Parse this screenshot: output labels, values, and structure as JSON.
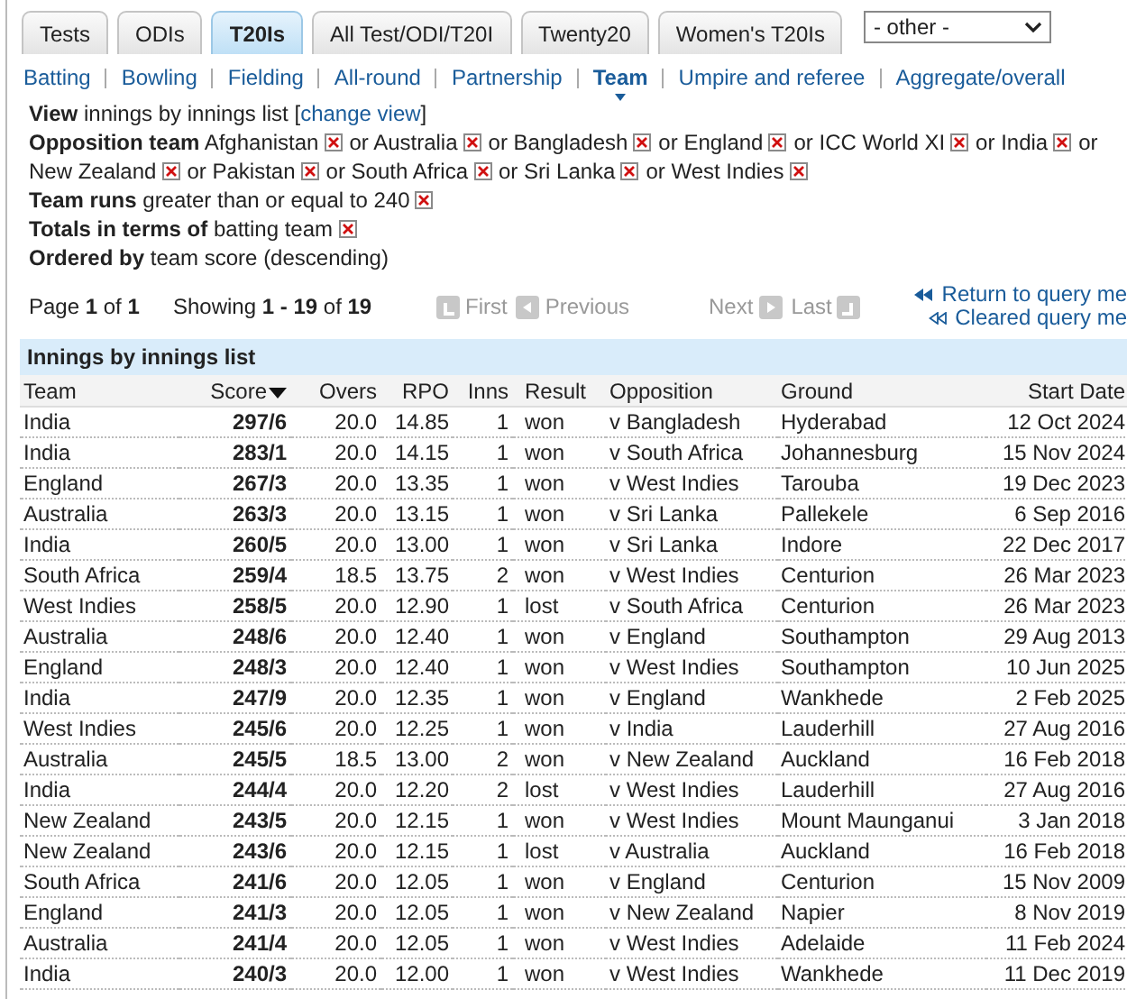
{
  "tabs": [
    {
      "label": "Tests",
      "selected": false
    },
    {
      "label": "ODIs",
      "selected": false
    },
    {
      "label": "T20Is",
      "selected": true
    },
    {
      "label": "All Test/ODI/T20I",
      "selected": false
    },
    {
      "label": "Twenty20",
      "selected": false
    },
    {
      "label": "Women's T20Is",
      "selected": false
    }
  ],
  "other_select": {
    "value": "- other -"
  },
  "subnav": [
    {
      "label": "Batting",
      "selected": false
    },
    {
      "label": "Bowling",
      "selected": false
    },
    {
      "label": "Fielding",
      "selected": false
    },
    {
      "label": "All-round",
      "selected": false
    },
    {
      "label": "Partnership",
      "selected": false
    },
    {
      "label": "Team",
      "selected": true
    },
    {
      "label": "Umpire and referee",
      "selected": false
    },
    {
      "label": "Aggregate/overall",
      "selected": false
    }
  ],
  "view": {
    "label": "View",
    "text": "innings by innings list",
    "open_bracket": "[",
    "link": "change view",
    "close_bracket": "]"
  },
  "criteria": [
    {
      "label": "Opposition team",
      "values": [
        {
          "text": "Afghanistan"
        },
        {
          "prefix": "or",
          "text": "Australia"
        },
        {
          "prefix": "or",
          "text": "Bangladesh"
        },
        {
          "prefix": "or",
          "text": "England"
        },
        {
          "prefix": "or",
          "text": "ICC World XI"
        },
        {
          "prefix": "or",
          "text": "India"
        },
        {
          "prefix": "or",
          "text": "New Zealand"
        },
        {
          "prefix": "or",
          "text": "Pakistan"
        },
        {
          "prefix": "or",
          "text": "South Africa"
        },
        {
          "prefix": "or",
          "text": "Sri Lanka"
        },
        {
          "prefix": "or",
          "text": "West Indies"
        }
      ]
    },
    {
      "label": "Team runs",
      "values": [
        {
          "text": "greater than or equal to 240"
        }
      ]
    },
    {
      "label": "Totals in terms of",
      "values": [
        {
          "text": "batting team"
        }
      ]
    }
  ],
  "ordered_by": {
    "label": "Ordered by",
    "text": "team score (descending)"
  },
  "pagination": {
    "page": "Page **1** of **1**",
    "showing": "Showing **1 - 19** of **19**",
    "buttons": [
      {
        "label": "First",
        "kind": "first",
        "disabled": true
      },
      {
        "label": "Previous",
        "kind": "previous",
        "disabled": true
      },
      {
        "label": "Next",
        "kind": "next",
        "disabled": true
      },
      {
        "label": "Last",
        "kind": "last",
        "disabled": true
      }
    ]
  },
  "query_links": [
    "Return to query me",
    "Cleared query me"
  ],
  "table": {
    "title": "Innings by innings list",
    "columns": [
      {
        "label": "Team",
        "sorted": false
      },
      {
        "label": "Score",
        "sorted": true
      },
      {
        "label": "Overs",
        "sorted": false
      },
      {
        "label": "RPO",
        "sorted": false
      },
      {
        "label": "Inns",
        "sorted": false
      },
      {
        "label": "Result",
        "sorted": false
      },
      {
        "label": "Opposition",
        "sorted": false
      },
      {
        "label": "Ground",
        "sorted": false
      },
      {
        "label": "Start Date",
        "sorted": false
      }
    ],
    "rows": [
      [
        "India",
        "297/6",
        "20.0",
        "14.85",
        "1",
        "won",
        "v Bangladesh",
        "Hyderabad",
        "12 Oct 2024"
      ],
      [
        "India",
        "283/1",
        "20.0",
        "14.15",
        "1",
        "won",
        "v South Africa",
        "Johannesburg",
        "15 Nov 2024"
      ],
      [
        "England",
        "267/3",
        "20.0",
        "13.35",
        "1",
        "won",
        "v West Indies",
        "Tarouba",
        "19 Dec 2023"
      ],
      [
        "Australia",
        "263/3",
        "20.0",
        "13.15",
        "1",
        "won",
        "v Sri Lanka",
        "Pallekele",
        "6 Sep 2016"
      ],
      [
        "India",
        "260/5",
        "20.0",
        "13.00",
        "1",
        "won",
        "v Sri Lanka",
        "Indore",
        "22 Dec 2017"
      ],
      [
        "South Africa",
        "259/4",
        "18.5",
        "13.75",
        "2",
        "won",
        "v West Indies",
        "Centurion",
        "26 Mar 2023"
      ],
      [
        "West Indies",
        "258/5",
        "20.0",
        "12.90",
        "1",
        "lost",
        "v South Africa",
        "Centurion",
        "26 Mar 2023"
      ],
      [
        "Australia",
        "248/6",
        "20.0",
        "12.40",
        "1",
        "won",
        "v England",
        "Southampton",
        "29 Aug 2013"
      ],
      [
        "England",
        "248/3",
        "20.0",
        "12.40",
        "1",
        "won",
        "v West Indies",
        "Southampton",
        "10 Jun 2025"
      ],
      [
        "India",
        "247/9",
        "20.0",
        "12.35",
        "1",
        "won",
        "v England",
        "Wankhede",
        "2 Feb 2025"
      ],
      [
        "West Indies",
        "245/6",
        "20.0",
        "12.25",
        "1",
        "won",
        "v India",
        "Lauderhill",
        "27 Aug 2016"
      ],
      [
        "Australia",
        "245/5",
        "18.5",
        "13.00",
        "2",
        "won",
        "v New Zealand",
        "Auckland",
        "16 Feb 2018"
      ],
      [
        "India",
        "244/4",
        "20.0",
        "12.20",
        "2",
        "lost",
        "v West Indies",
        "Lauderhill",
        "27 Aug 2016"
      ],
      [
        "New Zealand",
        "243/5",
        "20.0",
        "12.15",
        "1",
        "won",
        "v West Indies",
        "Mount Maunganui",
        "3 Jan 2018"
      ],
      [
        "New Zealand",
        "243/6",
        "20.0",
        "12.15",
        "1",
        "lost",
        "v Australia",
        "Auckland",
        "16 Feb 2018"
      ],
      [
        "South Africa",
        "241/6",
        "20.0",
        "12.05",
        "1",
        "won",
        "v England",
        "Centurion",
        "15 Nov 2009"
      ],
      [
        "England",
        "241/3",
        "20.0",
        "12.05",
        "1",
        "won",
        "v New Zealand",
        "Napier",
        "8 Nov 2019"
      ],
      [
        "Australia",
        "241/4",
        "20.0",
        "12.05",
        "1",
        "won",
        "v West Indies",
        "Adelaide",
        "11 Feb 2024"
      ],
      [
        "India",
        "240/3",
        "20.0",
        "12.00",
        "1",
        "won",
        "v West Indies",
        "Wankhede",
        "11 Dec 2019"
      ]
    ]
  }
}
